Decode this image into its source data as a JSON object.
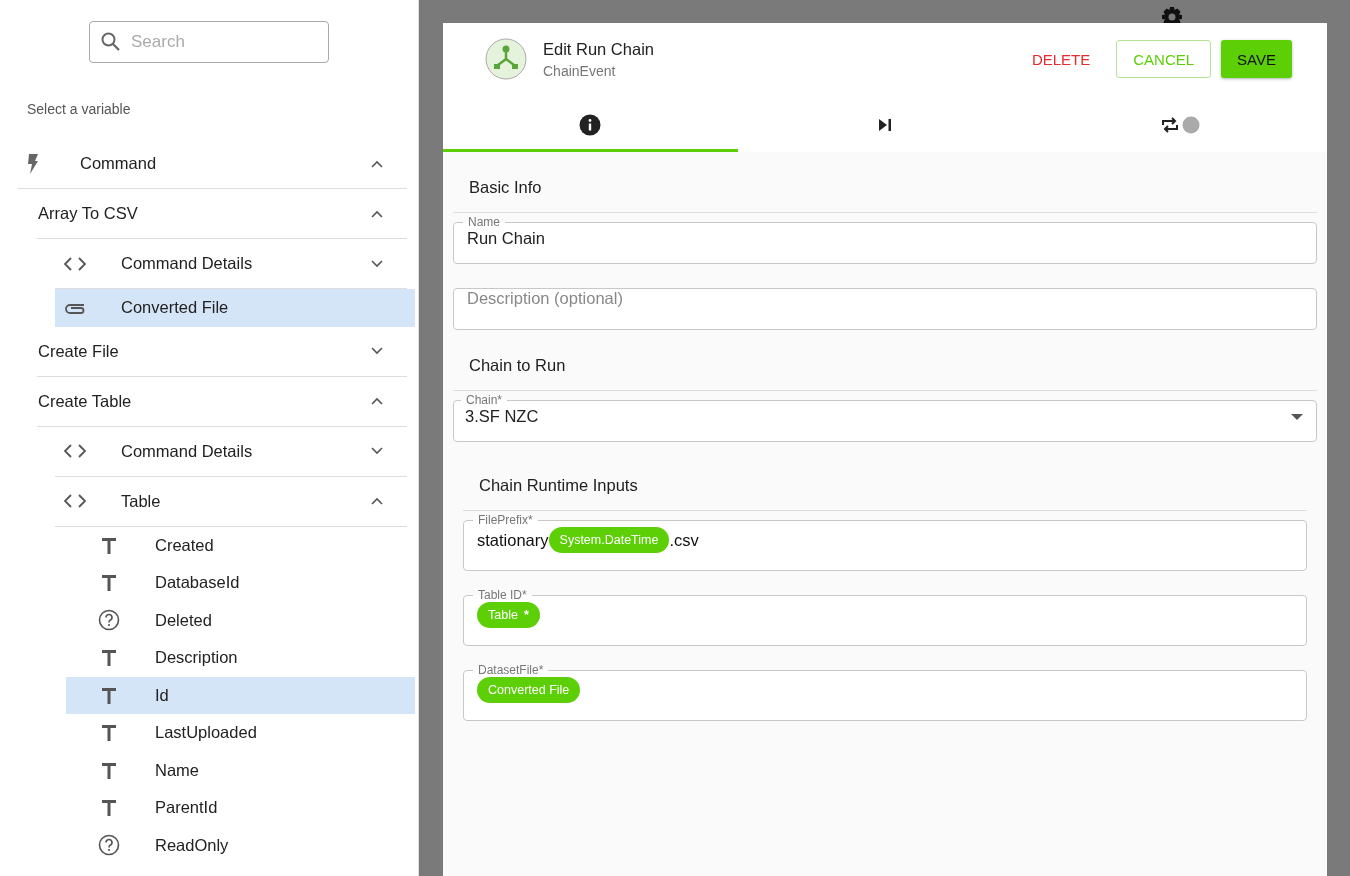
{
  "search": {
    "placeholder": "Search"
  },
  "variables_heading": "Select a variable",
  "tree": [
    {
      "label": "Command",
      "kind": "bolt",
      "expanded": true,
      "selected": false,
      "children": [
        {
          "label": "Array To CSV",
          "kind": "plain",
          "expanded": true,
          "selected": false,
          "children": [
            {
              "label": "Command Details",
              "kind": "code",
              "expanded": false,
              "selected": false
            },
            {
              "label": "Converted File",
              "kind": "clip",
              "selected": true
            }
          ]
        },
        {
          "label": "Create File",
          "kind": "plain",
          "expanded": false,
          "selected": false
        },
        {
          "label": "Create Table",
          "kind": "plain",
          "expanded": true,
          "selected": false,
          "children": [
            {
              "label": "Command Details",
              "kind": "code",
              "expanded": false,
              "selected": false
            },
            {
              "label": "Table",
              "kind": "code",
              "expanded": true,
              "selected": false,
              "children": [
                {
                  "label": "Created",
                  "kind": "text",
                  "selected": false
                },
                {
                  "label": "DatabaseId",
                  "kind": "text",
                  "selected": false
                },
                {
                  "label": "Deleted",
                  "kind": "bool",
                  "selected": false
                },
                {
                  "label": "Description",
                  "kind": "text",
                  "selected": false
                },
                {
                  "label": "Id",
                  "kind": "text",
                  "selected": true
                },
                {
                  "label": "LastUploaded",
                  "kind": "text",
                  "selected": false
                },
                {
                  "label": "Name",
                  "kind": "text",
                  "selected": false
                },
                {
                  "label": "ParentId",
                  "kind": "text",
                  "selected": false
                },
                {
                  "label": "ReadOnly",
                  "kind": "bool",
                  "selected": false
                }
              ]
            }
          ]
        }
      ]
    }
  ],
  "dialog": {
    "title": "Edit Run Chain",
    "subtitle": "ChainEvent",
    "buttons": [
      {
        "kind": "danger",
        "label": "DELETE"
      },
      {
        "kind": "outline",
        "label": "CANCEL"
      },
      {
        "kind": "primary",
        "label": "SAVE"
      }
    ],
    "tabs": [
      {
        "kind": "info",
        "selected": true
      },
      {
        "kind": "skip",
        "selected": false
      },
      {
        "kind": "repeat",
        "selected": false
      }
    ],
    "sections": [
      {
        "heading": "Basic Info",
        "fields": [
          {
            "kind": "text",
            "label": "Name",
            "value": "Run Chain"
          },
          {
            "kind": "text",
            "placeholder": "Description (optional)"
          }
        ]
      },
      {
        "heading": "Chain to Run",
        "fields": [
          {
            "kind": "select",
            "label": "Chain*",
            "value": "3.SF NZC"
          }
        ]
      },
      {
        "heading": "Chain Runtime Inputs",
        "fields": [
          {
            "kind": "tokens",
            "label": "FilePrefix*",
            "parts": [
              {
                "kind": "text",
                "text": "stationary"
              },
              {
                "kind": "chip",
                "text": "System.DateTime"
              },
              {
                "kind": "text",
                "text": ".csv"
              }
            ]
          },
          {
            "kind": "tokens",
            "label": "Table ID*",
            "parts": [
              {
                "kind": "chip",
                "text": "Table",
                "suffix": "*"
              }
            ]
          },
          {
            "kind": "tokens",
            "label": "DatasetFile*",
            "parts": [
              {
                "kind": "chip",
                "text": "Converted File"
              }
            ]
          }
        ]
      }
    ]
  }
}
